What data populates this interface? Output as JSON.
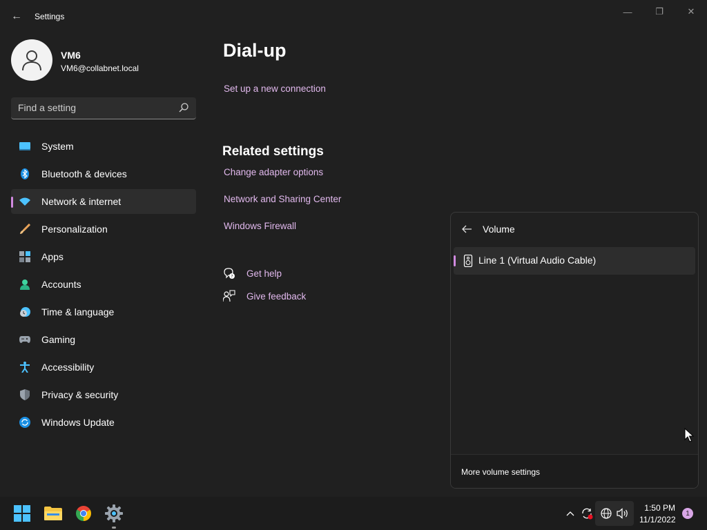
{
  "window": {
    "title": "Settings",
    "back_glyph": "←",
    "minimize_glyph": "—",
    "maximize_glyph": "❐",
    "close_glyph": "✕"
  },
  "profile": {
    "name": "VM6",
    "email": "VM6@collabnet.local"
  },
  "search": {
    "placeholder": "Find a setting"
  },
  "nav": {
    "items": [
      {
        "label": "System",
        "icon": "system-icon",
        "active": false
      },
      {
        "label": "Bluetooth & devices",
        "icon": "bluetooth-icon",
        "active": false
      },
      {
        "label": "Network & internet",
        "icon": "wifi-icon",
        "active": true
      },
      {
        "label": "Personalization",
        "icon": "brush-icon",
        "active": false
      },
      {
        "label": "Apps",
        "icon": "apps-icon",
        "active": false
      },
      {
        "label": "Accounts",
        "icon": "accounts-icon",
        "active": false
      },
      {
        "label": "Time & language",
        "icon": "time-language-icon",
        "active": false
      },
      {
        "label": "Gaming",
        "icon": "gamepad-icon",
        "active": false
      },
      {
        "label": "Accessibility",
        "icon": "accessibility-icon",
        "active": false
      },
      {
        "label": "Privacy & security",
        "icon": "shield-icon",
        "active": false
      },
      {
        "label": "Windows Update",
        "icon": "update-icon",
        "active": false
      }
    ]
  },
  "main": {
    "title": "Dial-up",
    "setup_link": "Set up a new connection",
    "related_title": "Related settings",
    "related_links": [
      "Change adapter options",
      "Network and Sharing Center",
      "Windows Firewall"
    ],
    "get_help": "Get help",
    "give_feedback": "Give feedback"
  },
  "flyout": {
    "title": "Volume",
    "device": "Line 1 (Virtual Audio Cable)",
    "more_settings": "More volume settings"
  },
  "taskbar": {
    "time": "1:50 PM",
    "date": "11/1/2022",
    "notification_count": "1",
    "chevron_glyph": "^"
  },
  "colors": {
    "background": "#202020",
    "accent": "#d18ae0",
    "link": "#e2b9ee",
    "taskbar": "#1c1c1c"
  }
}
